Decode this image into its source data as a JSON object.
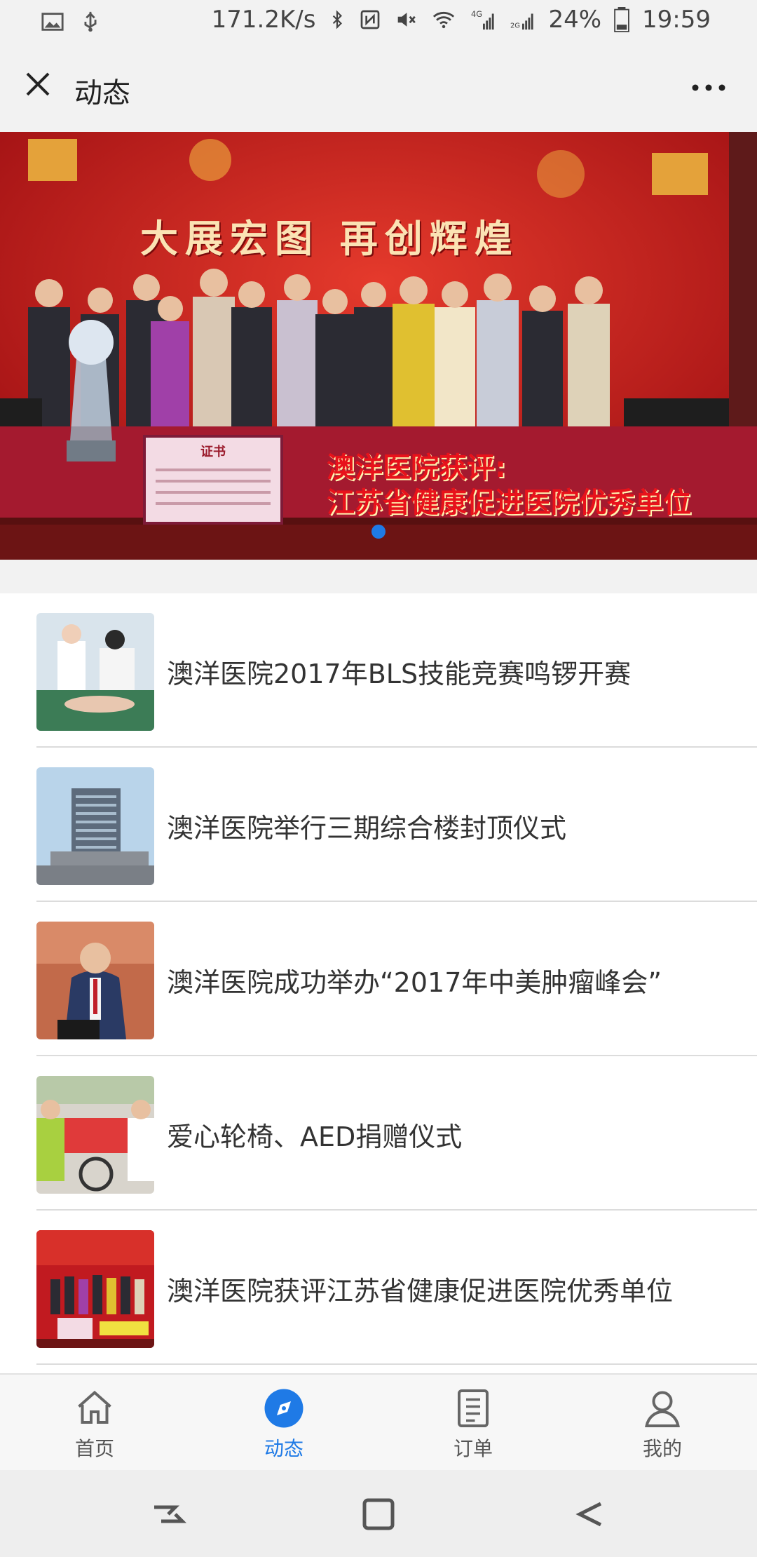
{
  "status_bar": {
    "network_speed": "171.2K/s",
    "battery": "24%",
    "time": "19:59",
    "icons": [
      "image-icon",
      "usb-icon",
      "bluetooth-icon",
      "nfc-icon",
      "mute-icon",
      "wifi-icon",
      "signal-4g-icon",
      "signal-2g-icon",
      "battery-icon"
    ]
  },
  "app_bar": {
    "title": "动态",
    "close_icon": "close-icon",
    "more_icon": "more-icon"
  },
  "banner": {
    "slogan": "大展宏图 再创辉煌",
    "caption_line1": "澳洋医院获评:",
    "caption_line2": "江苏省健康促进医院优秀单位",
    "certificate_title": "证书",
    "page_dots": 1,
    "active_dot": 0
  },
  "news": [
    {
      "title": "澳洋医院2017年BLS技能竞赛鸣锣开赛",
      "thumb": "bls-training-photo"
    },
    {
      "title": "澳洋医院举行三期综合楼封顶仪式",
      "thumb": "building-photo"
    },
    {
      "title": "澳洋医院成功举办“2017年中美肿瘤峰会”",
      "thumb": "speaker-photo"
    },
    {
      "title": "爱心轮椅、AED捐赠仪式",
      "thumb": "donation-photo"
    },
    {
      "title": "澳洋医院获评江苏省健康促进医院优秀单位",
      "thumb": "award-photo"
    }
  ],
  "bottom_nav": [
    {
      "label": "首页",
      "icon": "home-icon",
      "active": false
    },
    {
      "label": "动态",
      "icon": "compass-icon",
      "active": true
    },
    {
      "label": "订单",
      "icon": "orders-icon",
      "active": false
    },
    {
      "label": "我的",
      "icon": "profile-icon",
      "active": false
    }
  ],
  "colors": {
    "accent": "#1f7ae6",
    "bar_background": "#f2f2f2",
    "banner_red": "#b3141a",
    "caption_red": "#e8121b"
  }
}
